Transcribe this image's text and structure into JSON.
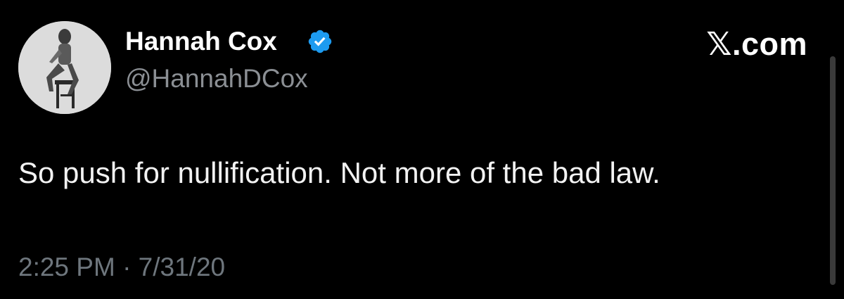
{
  "author": {
    "display_name": "Hannah Cox",
    "handle": "@HannahDCox",
    "avatar_icon": "profile-photo",
    "verified_icon": "verified-badge-icon",
    "verified_color": "#1d9bf0"
  },
  "brand": {
    "label": "𝕏.com"
  },
  "tweet": {
    "text": "So push for nullification. Not more of the bad law.",
    "timestamp": "2:25 PM · 7/31/20"
  },
  "colors": {
    "background": "#000000",
    "name": "#ffffff",
    "handle": "#8b8f94",
    "body": "#f2f2f2",
    "timestamp": "#6e767d"
  }
}
